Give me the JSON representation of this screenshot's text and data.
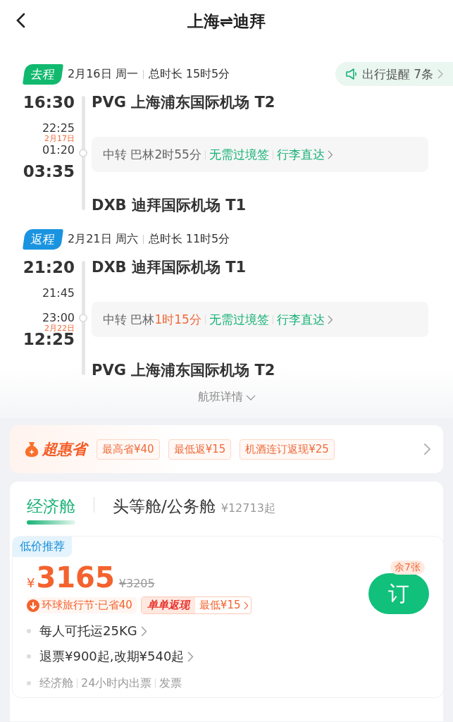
{
  "header": {
    "title": "上海⇌迪拜"
  },
  "reminder": {
    "text": "出行提醒 7条"
  },
  "legs": [
    {
      "kind": "outbound",
      "badge": "去程",
      "date": "2月16日 周一",
      "duration": "总时长 15时5分",
      "depart_time": "16:30",
      "depart_airport": "PVG 上海浦东国际机场 T2",
      "arrive_time": "03:35",
      "arrive_airport": "DXB 迪拜国际机场 T1",
      "transfer": {
        "arrive": "22:25",
        "date_note": "2月17日",
        "depart": "01:20",
        "label": "中转",
        "city": "巴林",
        "layover": "2时55分",
        "short_layover": false,
        "visa": "无需过境签",
        "baggage": "行李直达"
      }
    },
    {
      "kind": "return",
      "badge": "返程",
      "date": "2月21日 周六",
      "duration": "总时长 11时5分",
      "depart_time": "21:20",
      "depart_airport": "DXB 迪拜国际机场 T1",
      "arrive_time": "12:25",
      "arrive_date_note": "2月22日",
      "arrive_airport": "PVG 上海浦东国际机场 T2",
      "transfer": {
        "arrive": "21:45",
        "depart": "23:00",
        "label": "中转",
        "city": "巴林",
        "layover": "1时15分",
        "short_layover": true,
        "visa": "无需过境签",
        "baggage": "行李直达"
      }
    }
  ],
  "details_link": "航班详情",
  "promo": {
    "brand": "超惠省",
    "tags": [
      "最高省¥40",
      "最低返¥15",
      "机酒连订返现¥25"
    ]
  },
  "cabins": [
    {
      "label": "经济舱",
      "selected": true
    },
    {
      "label": "头等舱/公务舱",
      "price": "¥12713起",
      "selected": false
    }
  ],
  "offer": {
    "badge": "低价推荐",
    "currency": "¥",
    "price": "3165",
    "original_price": "¥3205",
    "discount": "环球旅行节·已省40",
    "cashback_label": "单单返现",
    "cashback_value": "最低¥15",
    "remaining": "余7张",
    "book": "订",
    "features": [
      {
        "text": "每人可托运25KG",
        "link": true
      },
      {
        "text": "退票¥900起,改期¥540起",
        "link": true
      }
    ],
    "tags": [
      "经济舱",
      "24小时内出票",
      "发票"
    ]
  }
}
